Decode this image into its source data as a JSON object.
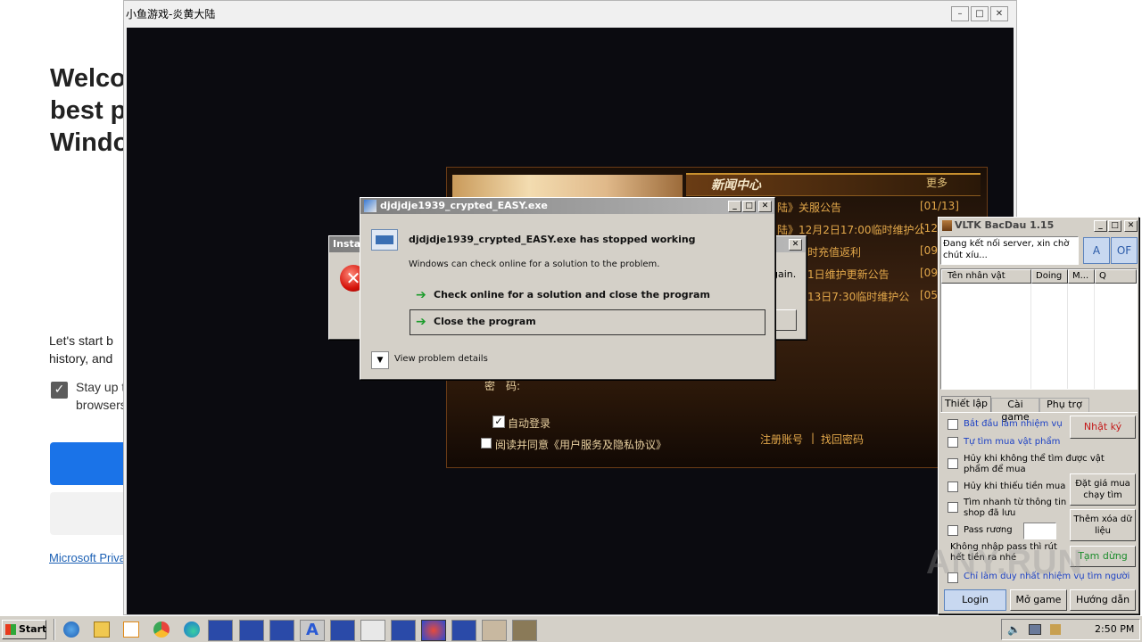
{
  "edge": {
    "heading_lines": [
      "Welco",
      "best p",
      "Windo"
    ],
    "para_lines": [
      "Let's start b",
      "history, and"
    ],
    "checkbox_lines": [
      "Stay up t",
      "browsers"
    ],
    "privacy_link": "Microsoft Priva",
    "checkbox_mark": "✓"
  },
  "game_window": {
    "title": "小鱼游戏-炎黄大陆",
    "min": "–",
    "max": "□",
    "close": "✕",
    "news_header": "新闻中心",
    "more": "更多",
    "news": [
      {
        "title": "陆》关服公告",
        "date": "[01/13]"
      },
      {
        "title": "陆》12月2日17:00临时维护公",
        "date": "[12/"
      },
      {
        "title": "时充值返利",
        "date": "[09/"
      },
      {
        "title": "1日维护更新公告",
        "date": "[09/"
      },
      {
        "title": "13日7:30临时维护公",
        "date": "[05/"
      }
    ],
    "password_label": "密　码:",
    "auto_login": "自动登录",
    "agree": "阅读并同意《用户服务及隐私协议》",
    "register": "注册账号",
    "separator": "|",
    "find_password": "找回密码",
    "hidden_text": "gain."
  },
  "install_dialog": {
    "title": "Insta",
    "close": "✕"
  },
  "error_dialog": {
    "title": "djdjdje1939_crypted_EASY.exe",
    "heading": "djdjdje1939_crypted_EASY.exe has stopped working",
    "sub": "Windows can check online for a solution to the problem.",
    "option1": "Check online for a solution and close the program",
    "option2": "Close the program",
    "details": "View problem details",
    "min": "_",
    "max": "□",
    "close": "✕"
  },
  "vltk": {
    "title": "VLTK BacDau 1.15",
    "status": "Đang kết nối server, xin chờ chút xíu...",
    "btn_a": "A",
    "btn_of": "OF",
    "columns": [
      "Tên nhân vật",
      "Doing",
      "M...",
      "Q"
    ],
    "tabs": [
      "Thiết lập",
      "Cài game",
      "Phụ trợ"
    ],
    "options": [
      "Bắt đầu làm nhiệm vụ",
      "Tự tìm mua vật phẩm",
      "Hủy khi không thể tìm được vật phẩm để mua",
      "Hủy khi thiếu tiền mua",
      "Tìm nhanh từ thông tin shop đã lưu",
      "Pass rương"
    ],
    "note": "Không nhập pass thì rút hết tiền ra nhé",
    "last_option": "Chỉ làm duy nhất nhiệm vụ tìm người",
    "side_buttons": [
      "Nhật ký",
      "Đặt giá mua chạy tìm",
      "Thêm xóa dữ liệu",
      "Tạm dừng"
    ],
    "bottom_buttons": [
      "Login",
      "Mở game",
      "Hướng dẫn"
    ],
    "min": "_",
    "max": "□",
    "close": "✕"
  },
  "taskbar": {
    "start": "Start",
    "time": "2:50 PM"
  },
  "watermark": "ANY.RUN",
  "colors": {
    "classic_face": "#d4d0c8",
    "title_active": "#0a246a",
    "news_gold": "#e3a84a",
    "edge_blue": "#1a73e8"
  }
}
